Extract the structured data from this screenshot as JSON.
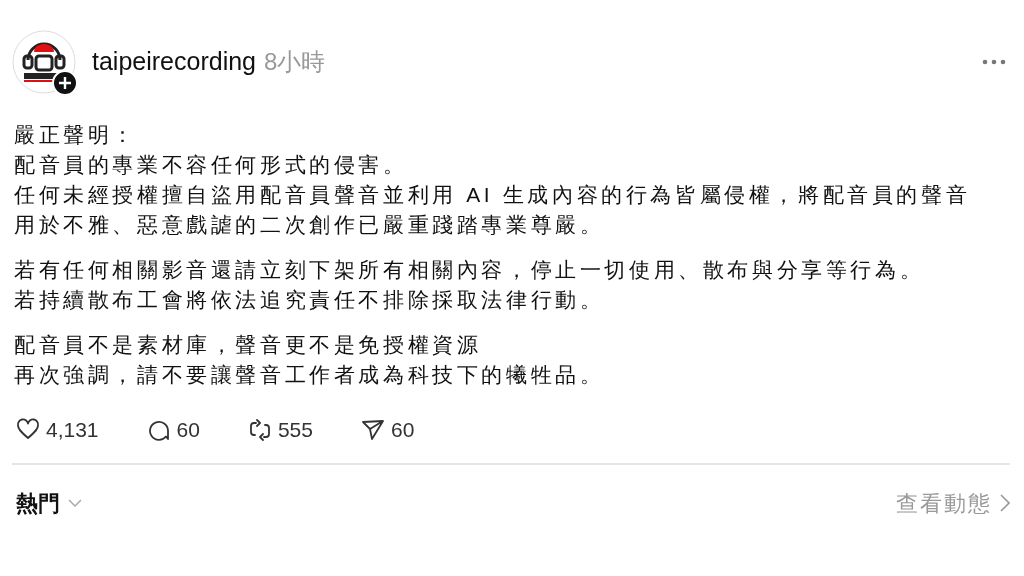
{
  "post": {
    "username": "taipeirecording",
    "time": "8小時",
    "paragraphs": [
      [
        "嚴正聲明：",
        "配音員的專業不容任何形式的侵害。",
        "任何未經授權擅自盜用配音員聲音並利用 AI 生成內容的行為皆屬侵權，將配音員的聲音",
        "用於不雅、惡意戲謔的二次創作已嚴重踐踏專業尊嚴。"
      ],
      [
        "若有任何相關影音還請立刻下架所有相關內容，停止一切使用、散布與分享等行為。",
        "若持續散布工會將依法追究責任不排除採取法律行動。"
      ],
      [
        "配音員不是素材庫，聲音更不是免授權資源",
        "再次強調，請不要讓聲音工作者成為科技下的犧牲品。"
      ]
    ],
    "actions": [
      {
        "kind": "like",
        "count": "4,131"
      },
      {
        "kind": "comment",
        "count": "60"
      },
      {
        "kind": "repost",
        "count": "555"
      },
      {
        "kind": "share",
        "count": "60"
      }
    ]
  },
  "footer": {
    "sort": "熱門",
    "link": "查看動態"
  }
}
